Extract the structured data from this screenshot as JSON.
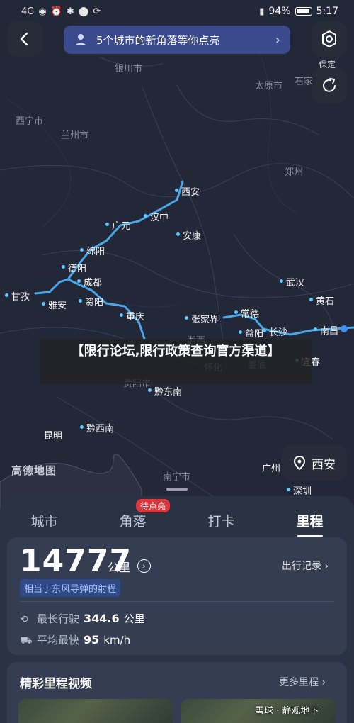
{
  "status_bar": {
    "network": "4G",
    "battery": "94%",
    "time": "5:17"
  },
  "banner": {
    "text": "5个城市的新角落等你点亮",
    "chevron": "chevron-right-icon"
  },
  "buttons": {
    "back": "back-icon",
    "settings": "settings-icon",
    "settings_label": "保定",
    "share": "share-icon"
  },
  "map": {
    "brand": "高德地图",
    "cities": {
      "yinchuan": "银川市",
      "taiyuan": "太原市",
      "xining": "西宁市",
      "lanzhou": "兰州市",
      "zhengzhou": "郑州",
      "shi": "石家",
      "xian": "西安",
      "hanzhong": "汉中",
      "guangyuan": "广元",
      "ankang": "安康",
      "mianyang": "绵阳",
      "deyang": "德阳",
      "chengdu": "成都",
      "ganzi": "甘孜",
      "yaan": "雅安",
      "ziyang": "资阳",
      "chongqing": "重庆",
      "wuhan": "武汉",
      "huangshi": "黄石",
      "zhangjiajie": "张家界",
      "changde": "常德",
      "yiyang": "益阳",
      "changsha": "长沙",
      "nanchang": "南昌",
      "xiangxi": "湘西",
      "huaihua": "怀化",
      "loudi": "娄底",
      "yichun": "宜春",
      "guiyang": "贵阳市",
      "qiandongnan": "黔东南",
      "kunming": "昆明",
      "qianxinan": "黔西南",
      "nanning": "南宁市",
      "guangzhou": "广州",
      "shenzhen": "深圳"
    },
    "overlay_title": "【限行论坛,限行政策查询官方渠道】",
    "location_button": "西安"
  },
  "tabs": [
    {
      "label": "城市"
    },
    {
      "label": "角落",
      "badge": "待点亮"
    },
    {
      "label": "打卡"
    },
    {
      "label": "里程"
    }
  ],
  "mileage": {
    "total": "14777",
    "unit": "公里",
    "record_link": "出行记录 ›",
    "comparison": "相当于东风导弹的射程",
    "longest_label": "最长行驶",
    "longest_value": "344.6",
    "longest_unit": "公里",
    "fastest_label": "平均最快",
    "fastest_value": "95",
    "fastest_unit": "km/h"
  },
  "videos": {
    "title": "精彩里程视频",
    "more": "更多里程 ›",
    "credit": "雪球 · 静观地下"
  }
}
